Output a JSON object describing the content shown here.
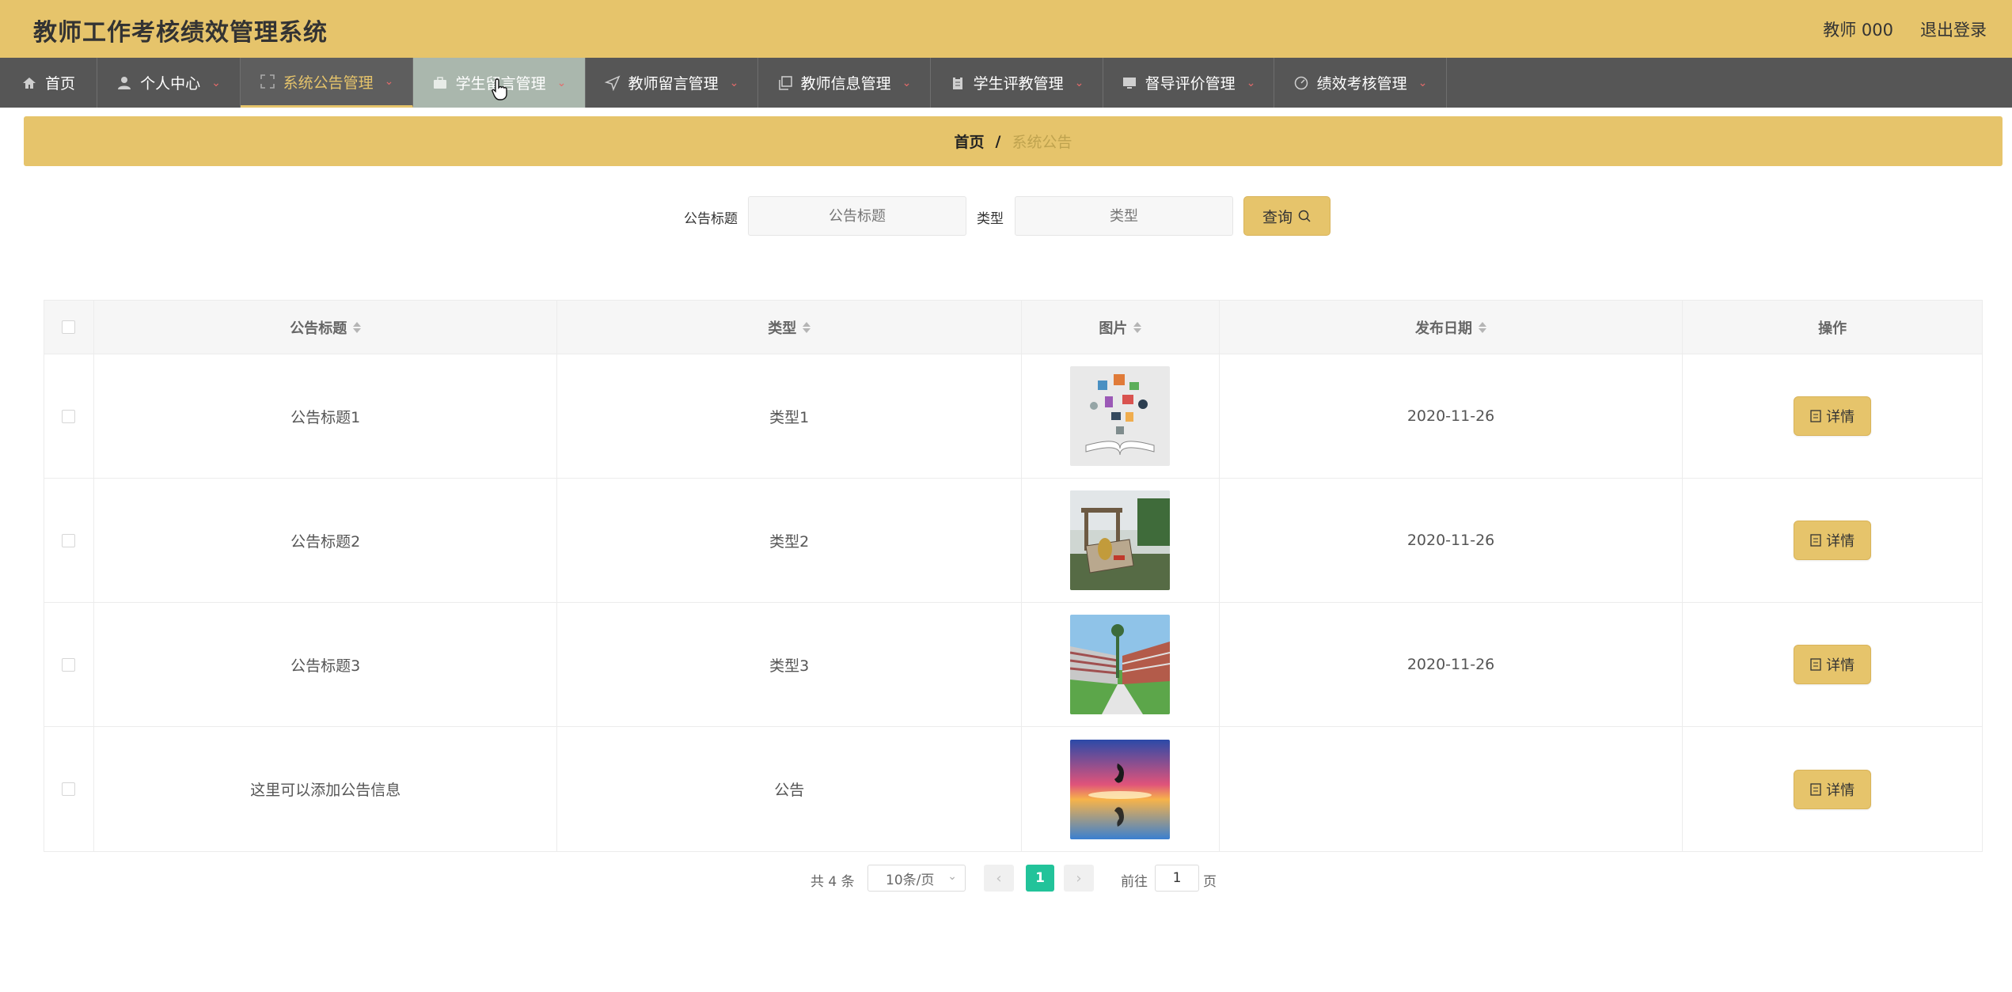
{
  "header": {
    "title": "教师工作考核绩效管理系统",
    "user": "教师 000",
    "logout": "退出登录",
    "bg_color": "#e6c46b"
  },
  "nav": {
    "items": [
      {
        "label": "首页",
        "icon": "home-icon"
      },
      {
        "label": "个人中心",
        "icon": "user-icon"
      },
      {
        "label": "系统公告管理",
        "icon": "fullscreen-icon"
      },
      {
        "label": "学生留言管理",
        "icon": "briefcase-icon"
      },
      {
        "label": "教师留言管理",
        "icon": "send-icon"
      },
      {
        "label": "教师信息管理",
        "icon": "copy-icon"
      },
      {
        "label": "学生评教管理",
        "icon": "clipboard-icon"
      },
      {
        "label": "督导评价管理",
        "icon": "monitor-icon"
      },
      {
        "label": "绩效考核管理",
        "icon": "gauge-icon"
      }
    ]
  },
  "breadcrumb": {
    "home": "首页",
    "separator": "/",
    "current": "系统公告"
  },
  "search": {
    "title_label": "公告标题",
    "title_placeholder": "公告标题",
    "type_label": "类型",
    "type_placeholder": "类型",
    "button": "查询"
  },
  "table": {
    "columns": [
      "公告标题",
      "类型",
      "图片",
      "发布日期",
      "操作"
    ],
    "rows": [
      {
        "title": "公告标题1",
        "type": "类型1",
        "image": "book-image",
        "date": "2020-11-26",
        "action": "详情"
      },
      {
        "title": "公告标题2",
        "type": "类型2",
        "image": "campus-gate-image",
        "date": "2020-11-26",
        "action": "详情"
      },
      {
        "title": "公告标题3",
        "type": "类型3",
        "image": "campus-building-image",
        "date": "2020-11-26",
        "action": "详情"
      },
      {
        "title": "这里可以添加公告信息",
        "type": "公告",
        "image": "dolphin-sunset-image",
        "date": "",
        "action": "详情"
      }
    ]
  },
  "pagination": {
    "total": "共 4 条",
    "page_size": "10条/页",
    "current_page": "1",
    "goto_label": "前往",
    "goto_value": "1",
    "page_suffix": "页",
    "active_color": "#22c39a"
  }
}
